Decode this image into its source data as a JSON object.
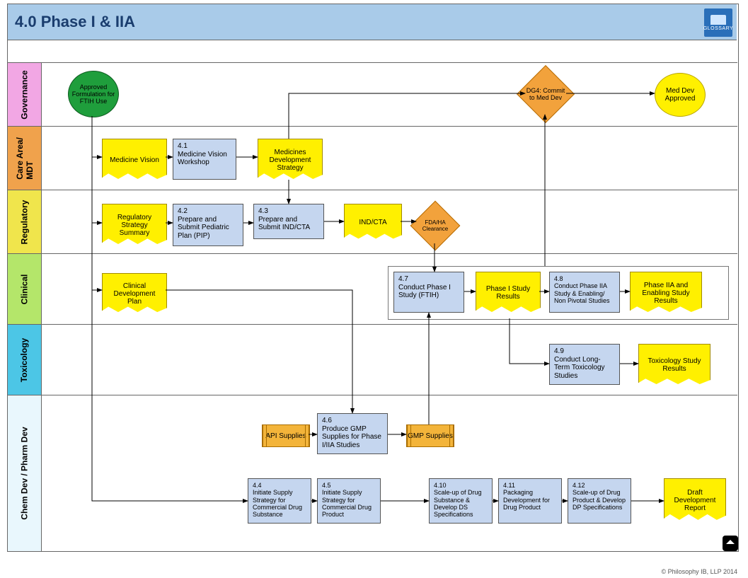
{
  "title": "4.0 Phase I & IIA",
  "glossary_label": "GLOSSARY",
  "footer": "© Philosophy IB, LLP 2014",
  "lanes": {
    "governance": "Governance",
    "care": "Care Area/\nMDT",
    "regulatory": "Regulatory",
    "clinical": "Clinical",
    "toxicology": "Toxicology",
    "chem": "Chem Dev / Pharm Dev"
  },
  "nodes": {
    "start": "Approved Formulation for FTIH Use",
    "med_vision": "Medicine Vision",
    "n41": "4.1\nMedicine Vision Workshop",
    "med_strategy": "Medicines Development Strategy",
    "reg_summary": "Regulatory Strategy Summary",
    "n42": "4.2\nPrepare and Submit Pediatric Plan (PIP)",
    "n43": "4.3\nPrepare and Submit IND/CTA",
    "indcta": "IND/CTA",
    "fda": "FDA/HA Clearance",
    "dg4": "DG4: Commit to Med Dev",
    "meddev": "Med Dev Approved",
    "clin_plan": "Clinical Development Plan",
    "n47": "4.7\nConduct Phase I Study (FTIH)",
    "p1results": "Phase I Study Results",
    "n48": "4.8\nConduct Phase IIA Study & Enabling/ Non Pivotal Studies",
    "p2results": "Phase IIA and Enabling Study Results",
    "n49": "4.9\nConduct Long-Term Toxicology Studies",
    "toxresults": "Toxicology Study Results",
    "api": "API Supplies",
    "n46": "4.6\nProduce GMP Supplies for Phase I/IIA Studies",
    "gmp": "GMP Supplies",
    "n44": "4.4\nInitiate Supply Strategy for Commercial Drug Substance",
    "n45": "4.5\nInitiate Supply Strategy for Commercial Drug Product",
    "n410": "4.10\nScale-up of Drug Substance & Develop DS Specifications",
    "n411": "4.11\nPackaging Development for Drug Product",
    "n412": "4.12\nScale-up of Drug Product & Develop DP Specifications",
    "draft": "Draft Development Report"
  }
}
